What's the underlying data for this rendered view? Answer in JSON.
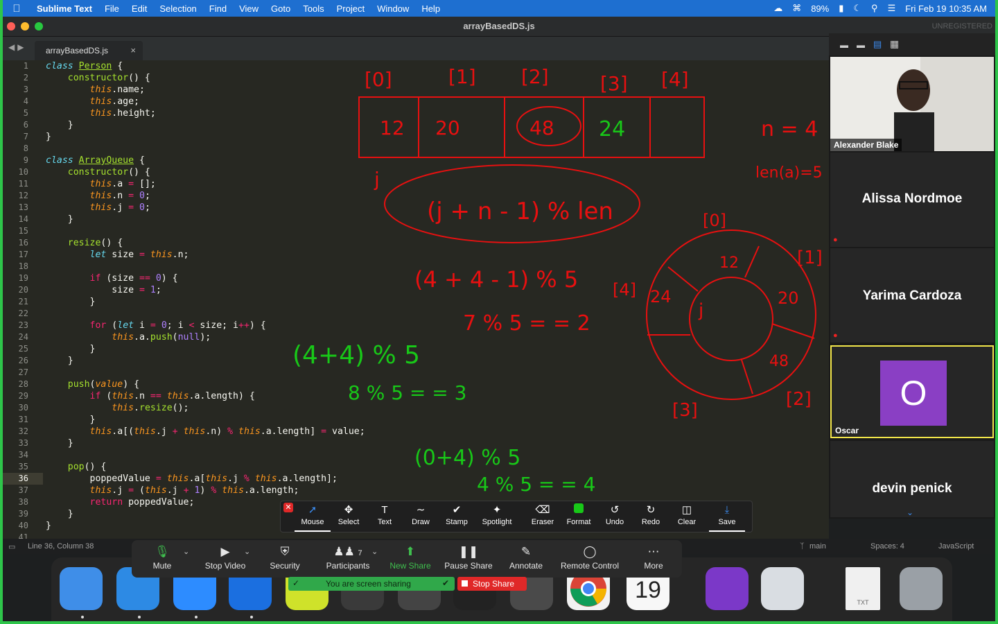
{
  "menubar": {
    "app": "Sublime Text",
    "items": [
      "File",
      "Edit",
      "Selection",
      "Find",
      "View",
      "Goto",
      "Tools",
      "Project",
      "Window",
      "Help"
    ],
    "battery": "89%",
    "clock": "Fri Feb 19  10:35 AM"
  },
  "window": {
    "title": "arrayBasedDS.js",
    "unregistered": "UNREGISTERED"
  },
  "tab": {
    "label": "arrayBasedDS.js",
    "close": "×"
  },
  "line_numbers": [
    "1",
    "2",
    "3",
    "4",
    "5",
    "6",
    "7",
    "8",
    "9",
    "10",
    "11",
    "12",
    "13",
    "14",
    "15",
    "16",
    "17",
    "18",
    "19",
    "20",
    "21",
    "22",
    "23",
    "24",
    "25",
    "26",
    "27",
    "28",
    "29",
    "30",
    "31",
    "32",
    "33",
    "34",
    "35",
    "36",
    "37",
    "38",
    "39",
    "40",
    "41"
  ],
  "code_text": {
    "l1a": "class",
    "l1b": "Person",
    "l1c": " {",
    "l2a": "constructor",
    "l2b": "() {",
    "this": "this",
    "l3b": ".name;",
    "l4b": ".age;",
    "l5b": ".height;",
    "brace_close": "}",
    "l9b": "ArrayQueue",
    "l11b": ".a ",
    "eq": "=",
    "l11c": " [];",
    "l12b": ".n ",
    "zero": "0",
    "semi": ";",
    "l13b": ".j ",
    "l16a": "resize",
    "l16b": "() {",
    "let": "let",
    "l17b": " size ",
    "l17c": ".n;",
    "if": "if",
    "l19b": " (size ",
    "eqeq": "==",
    "l19c": ") {",
    "l20a": "size ",
    "one": "1",
    "for": "for",
    "l23a": " (",
    "l23b": " i ",
    "l23c": "; i ",
    "lt": "<",
    "l23d": " size; i",
    "pp": "++",
    "l23e": ") {",
    "l24b": ".a.",
    "push": "push",
    "l24c": "(",
    "null": "null",
    "l24d": ");",
    "l28a": "push",
    "l28b": "(",
    "value": "value",
    "l28c": ") {",
    "l29b": " (",
    "l29c": ".n ",
    "l29d": ".a.length) {",
    "l30b": ".",
    "resize": "resize",
    "l30c": "();",
    "l32b": ".a[(",
    "l32c": ".j ",
    "plus": "+",
    "l32d": ".n) ",
    "pct": "%",
    "l32e": ".a.length] ",
    "l32f": " value;",
    "l35a": "pop",
    "l35b": "() {",
    "l36a": "poppedValue ",
    "l36b": ".a[",
    "l36c": ".j ",
    "l36d": ".a.length];",
    "l37b": ".j ",
    "l37c": " (",
    "l37d": ".j ",
    "l37e": ") ",
    "l37f": ".a.length;",
    "return": "return",
    "l38b": " poppedValue;"
  },
  "annotations": {
    "indices": [
      "[0]",
      "[1]",
      "[2]",
      "[3]",
      "[4]"
    ],
    "cells": [
      "12",
      "20",
      "48",
      "24",
      ""
    ],
    "j_label": "j",
    "n_eq": "n = 4",
    "len_eq": "len(a)=5",
    "formula": "(j + n - 1) % len",
    "calc1": "(4 + 4 - 1) % 5",
    "calc1_result": "7 % 5  = = 2",
    "calc2": "(4+4) % 5",
    "calc2_result": "8 % 5  = = 3",
    "calc3": "(0+4) % 5",
    "calc3_result": "4 % 5  = = 4",
    "ring_indices": [
      "[0]",
      "[1]",
      "[2]",
      "[3]",
      "[4]"
    ],
    "ring_values": [
      "12",
      "20",
      "48",
      "24"
    ],
    "ring_center": "j"
  },
  "statusbar": {
    "position": "Line 36, Column 38",
    "branch": "main",
    "spaces": "Spaces: 4",
    "syntax": "JavaScript"
  },
  "participants": [
    {
      "name": "Alexander Blake",
      "video": true
    },
    {
      "name": "Alissa Nordmoe"
    },
    {
      "name": "Yarima Cardoza"
    },
    {
      "name": "Oscar",
      "initial": "O",
      "avatar_color": "#8a3fc4"
    },
    {
      "name": "devin penick"
    }
  ],
  "annotate_toolbar": [
    "Mouse",
    "Select",
    "Text",
    "Draw",
    "Stamp",
    "Spotlight",
    "Eraser",
    "Format",
    "Undo",
    "Redo",
    "Clear",
    "Save"
  ],
  "meeting_controls": [
    "Mute",
    "Stop Video",
    "Security",
    "Participants",
    "New Share",
    "Pause Share",
    "Annotate",
    "Remote Control",
    "More"
  ],
  "participant_count": "7",
  "sharing": {
    "banner": "You are screen sharing",
    "stop": "Stop Share"
  },
  "dock": {
    "calendar_day": "19",
    "txt_label": "TXT"
  },
  "colors": {
    "accent": "#1e6fd0",
    "ink_red": "#e81010",
    "ink_green": "#18c818",
    "share_green": "#2ec54a"
  }
}
